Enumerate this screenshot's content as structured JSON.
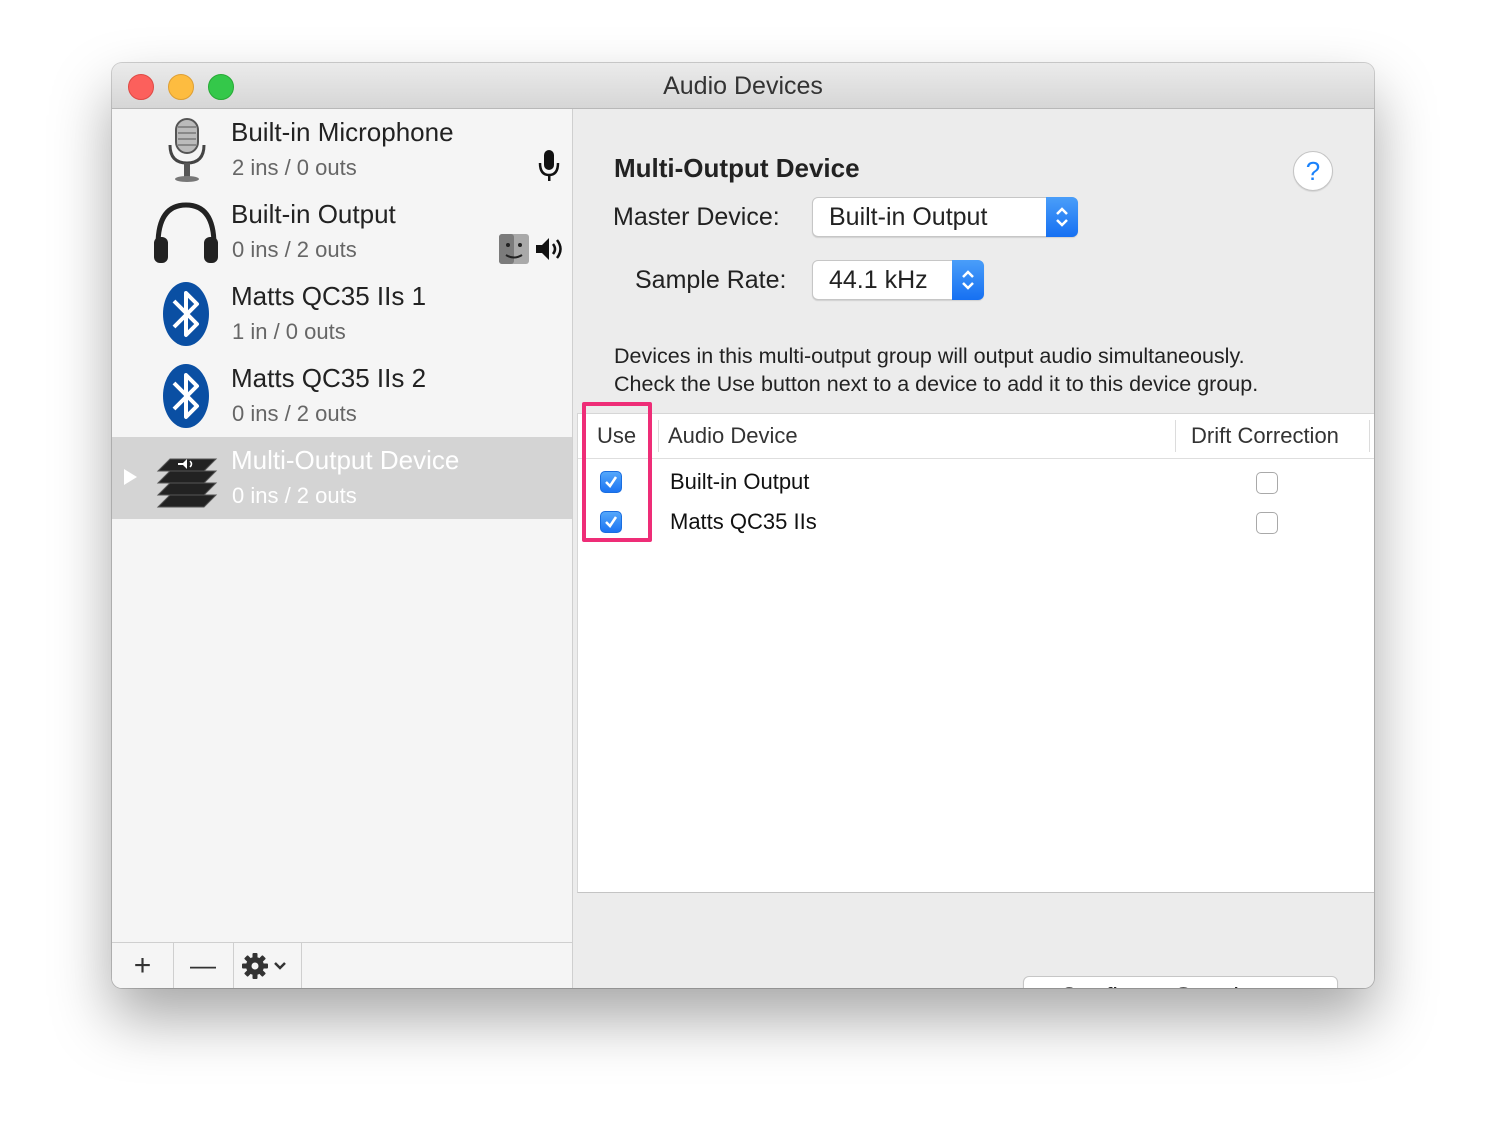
{
  "window": {
    "title": "Audio Devices"
  },
  "sidebar": {
    "devices": [
      {
        "name": "Built-in Microphone",
        "ios": "2 ins / 0 outs",
        "icon": "microphone-icon",
        "status": "default-input"
      },
      {
        "name": "Built-in Output",
        "ios": "0 ins / 2 outs",
        "icon": "headphones-icon",
        "status": "default-output-and-system"
      },
      {
        "name": "Matts QC35 IIs 1",
        "ios": "1 in / 0 outs",
        "icon": "bluetooth-icon"
      },
      {
        "name": "Matts QC35 IIs 2",
        "ios": "0 ins / 2 outs",
        "icon": "bluetooth-icon"
      },
      {
        "name": "Multi-Output Device",
        "ios": "0 ins / 2 outs",
        "icon": "multi-output-icon",
        "selected": true
      }
    ],
    "toolbar": {
      "add": "+",
      "remove": "—"
    }
  },
  "detail": {
    "heading": "Multi-Output Device",
    "help": "?",
    "master_device_label": "Master Device:",
    "master_device_value": "Built-in Output",
    "sample_rate_label": "Sample Rate:",
    "sample_rate_value": "44.1 kHz",
    "description_line1": "Devices in this multi-output group will output audio simultaneously.",
    "description_line2": "Check the Use button next to a device to add it to this device group.",
    "table": {
      "headers": {
        "use": "Use",
        "device": "Audio Device",
        "drift": "Drift Correction"
      },
      "rows": [
        {
          "use": true,
          "device": "Built-in Output",
          "drift": false
        },
        {
          "use": true,
          "device": "Matts QC35 IIs",
          "drift": false
        }
      ]
    },
    "configure_button": "Configure Speakers..."
  },
  "colors": {
    "accent": "#1a82fb",
    "highlight": "#ee2d77",
    "selection": "#d4d4d4"
  }
}
